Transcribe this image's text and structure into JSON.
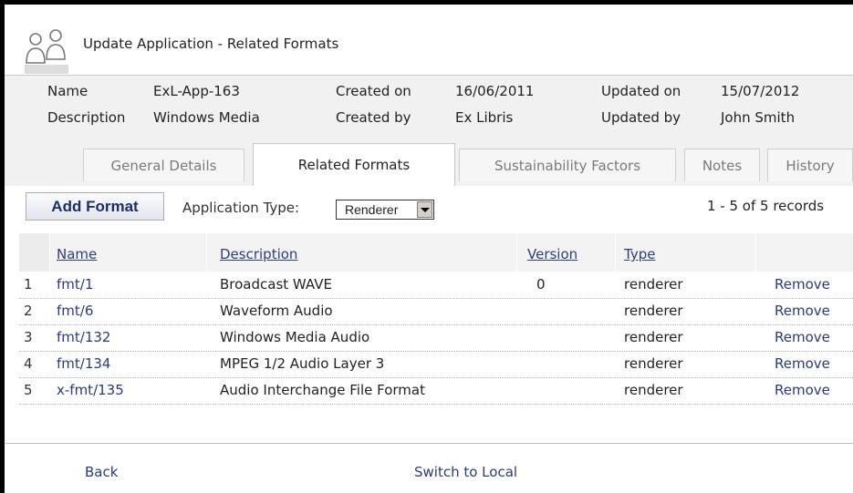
{
  "header": {
    "title": "Update Application - Related Formats",
    "icon": "users-icon"
  },
  "info": {
    "name_label": "Name",
    "name_value": "ExL-App-163",
    "description_label": "Description",
    "description_value": "Windows Media",
    "created_on_label": "Created on",
    "created_on_value": "16/06/2011",
    "created_by_label": "Created by",
    "created_by_value": "Ex Libris",
    "updated_on_label": "Updated on",
    "updated_on_value": "15/07/2012",
    "updated_by_label": "Updated by",
    "updated_by_value": "John Smith"
  },
  "tabs": [
    {
      "label": "General Details"
    },
    {
      "label": "Related Formats"
    },
    {
      "label": "Sustainability Factors"
    },
    {
      "label": "Notes"
    },
    {
      "label": "History"
    }
  ],
  "toolbar": {
    "add_label": "Add Format",
    "app_type_label": "Application Type:",
    "app_type_value": "Renderer",
    "records": "1 - 5 of 5 records"
  },
  "table": {
    "columns": [
      "Name",
      "Description",
      "Version",
      "Type"
    ],
    "rows": [
      {
        "num": "1",
        "name": "fmt/1",
        "description": "Broadcast WAVE",
        "version": "0",
        "type": "renderer",
        "action": "Remove"
      },
      {
        "num": "2",
        "name": "fmt/6",
        "description": "Waveform Audio",
        "version": "",
        "type": "renderer",
        "action": "Remove"
      },
      {
        "num": "3",
        "name": "fmt/132",
        "description": "Windows Media Audio",
        "version": "",
        "type": "renderer",
        "action": "Remove"
      },
      {
        "num": "4",
        "name": "fmt/134",
        "description": "MPEG 1/2 Audio Layer 3",
        "version": "",
        "type": "renderer",
        "action": "Remove"
      },
      {
        "num": "5",
        "name": "x-fmt/135",
        "description": "Audio Interchange File Format",
        "version": "",
        "type": "renderer",
        "action": "Remove"
      }
    ]
  },
  "footer": {
    "back": "Back",
    "switch": "Switch to Local"
  },
  "colors": {
    "link": "#2a3a7e",
    "panel": "#f1f1f1",
    "button_text": "#1c2f6b"
  }
}
